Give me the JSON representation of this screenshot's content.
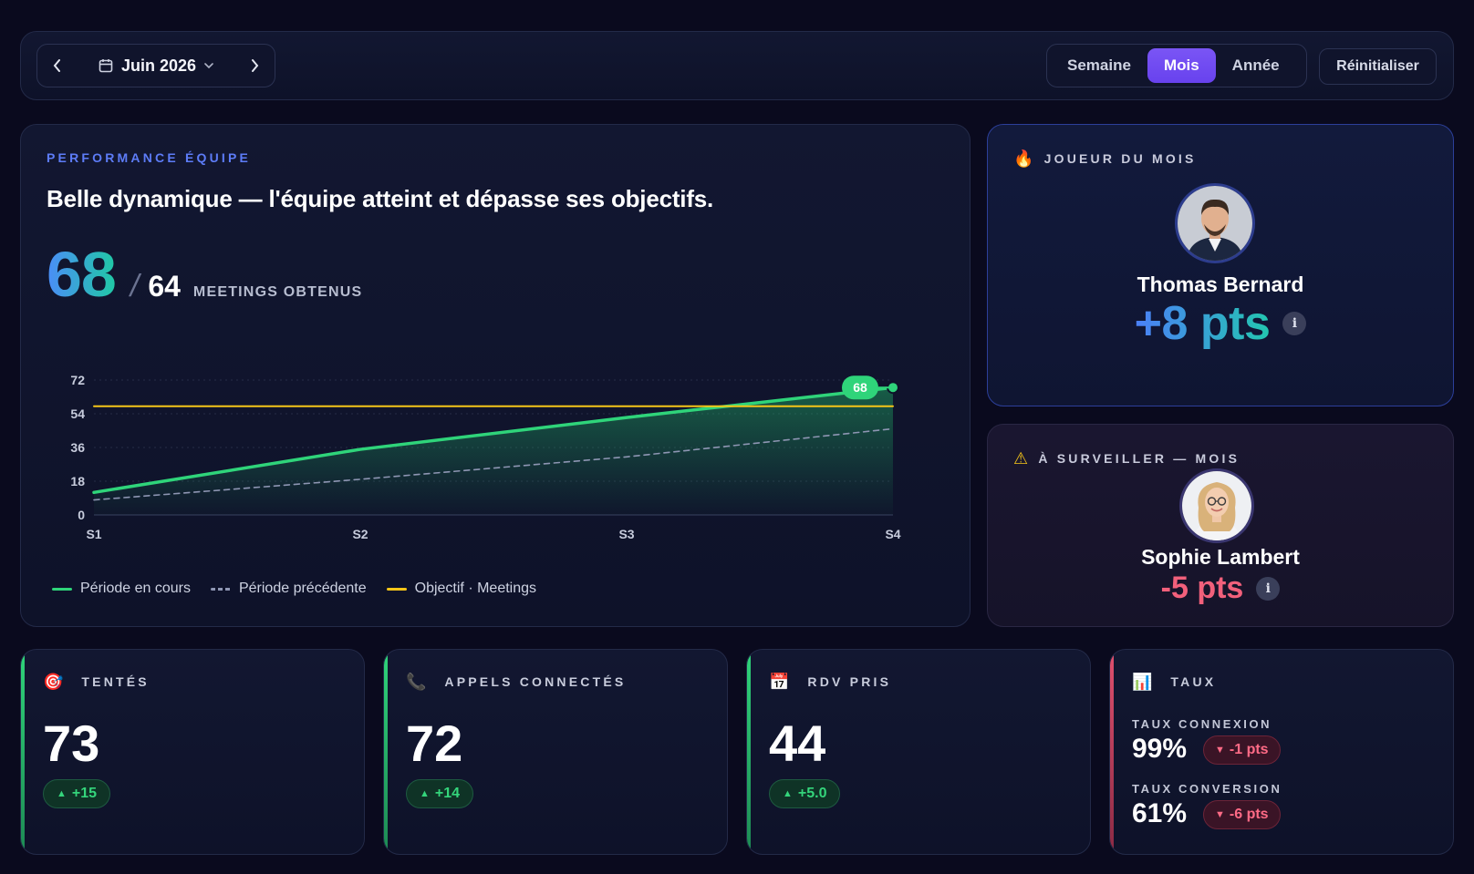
{
  "topbar": {
    "date_label": "Juin 2026",
    "periods": [
      "Semaine",
      "Mois",
      "Année"
    ],
    "active_period": "Mois",
    "reset_label": "Réinitialiser"
  },
  "performance": {
    "eyebrow": "PERFORMANCE ÉQUIPE",
    "headline": "Belle dynamique — l'équipe atteint et dépasse ses objectifs.",
    "value": "68",
    "slash": "/",
    "target": "64",
    "unit_label": "MEETINGS OBTENUS"
  },
  "chart_data": {
    "type": "line",
    "x": [
      "S1",
      "S2",
      "S3",
      "S4"
    ],
    "ylim": [
      0,
      72
    ],
    "yticks": [
      0,
      18,
      36,
      54,
      72
    ],
    "series": [
      {
        "name": "Période en cours",
        "values": [
          12,
          35,
          52,
          68
        ],
        "color": "#2fd47a",
        "style": "solid",
        "filled": true
      },
      {
        "name": "Période précédente",
        "values": [
          8,
          19,
          31,
          46
        ],
        "color": "#8e96b3",
        "style": "dashed"
      },
      {
        "name": "Objectif · Meetings",
        "values": [
          58,
          58,
          58,
          58
        ],
        "color": "#f5c518",
        "style": "solid"
      }
    ],
    "end_label": "68",
    "grid": true,
    "legend": "bottom-left"
  },
  "player_of_month": {
    "icon": "🔥",
    "eyebrow": "JOUEUR DU MOIS",
    "name": "Thomas Bernard",
    "score": "+8 pts",
    "info": "i"
  },
  "watch": {
    "icon": "⚠",
    "eyebrow": "À SURVEILLER — MOIS",
    "name": "Sophie Lambert",
    "score": "-5 pts",
    "info": "i"
  },
  "kpis": [
    {
      "icon": "🎯",
      "label": "TENTÉS",
      "value": "73",
      "delta": "+15",
      "accent": "#2fd47a"
    },
    {
      "icon": "📞",
      "label": "APPELS CONNECTÉS",
      "value": "72",
      "delta": "+14",
      "accent": "#2fd47a"
    },
    {
      "icon": "📅",
      "label": "RDV PRIS",
      "value": "44",
      "delta": "+5.0",
      "accent": "#2fd47a"
    }
  ],
  "rates": {
    "icon": "📊",
    "label": "TAUX",
    "accent": "#e0506e",
    "connexion_label": "TAUX CONNEXION",
    "connexion_value": "99%",
    "connexion_delta": "-1 pts",
    "conversion_label": "TAUX CONVERSION",
    "conversion_value": "61%",
    "conversion_delta": "-6 pts"
  }
}
